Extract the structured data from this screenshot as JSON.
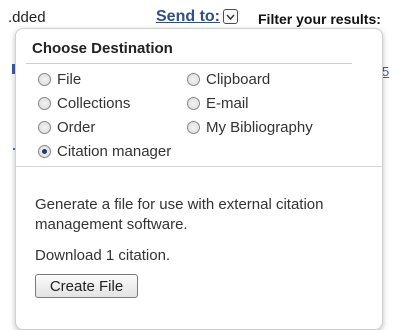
{
  "topbar": {
    "left_fragment": ".dded",
    "send_to_label": "Send to:",
    "filter_label": "Filter your results:"
  },
  "background": {
    "right_fragment": "5"
  },
  "popup": {
    "title": "Choose Destination",
    "options": [
      {
        "label": "File",
        "checked": false
      },
      {
        "label": "Clipboard",
        "checked": false
      },
      {
        "label": "Collections",
        "checked": false
      },
      {
        "label": "E-mail",
        "checked": false
      },
      {
        "label": "Order",
        "checked": false
      },
      {
        "label": "My Bibliography",
        "checked": false
      },
      {
        "label": "Citation manager",
        "checked": true
      }
    ],
    "description": "Generate a file for use with external citation management software.",
    "download_text": "Download 1 citation.",
    "button_label": "Create File"
  },
  "colors": {
    "link": "#2f4e8c",
    "popup_border": "#d0d0d0"
  }
}
